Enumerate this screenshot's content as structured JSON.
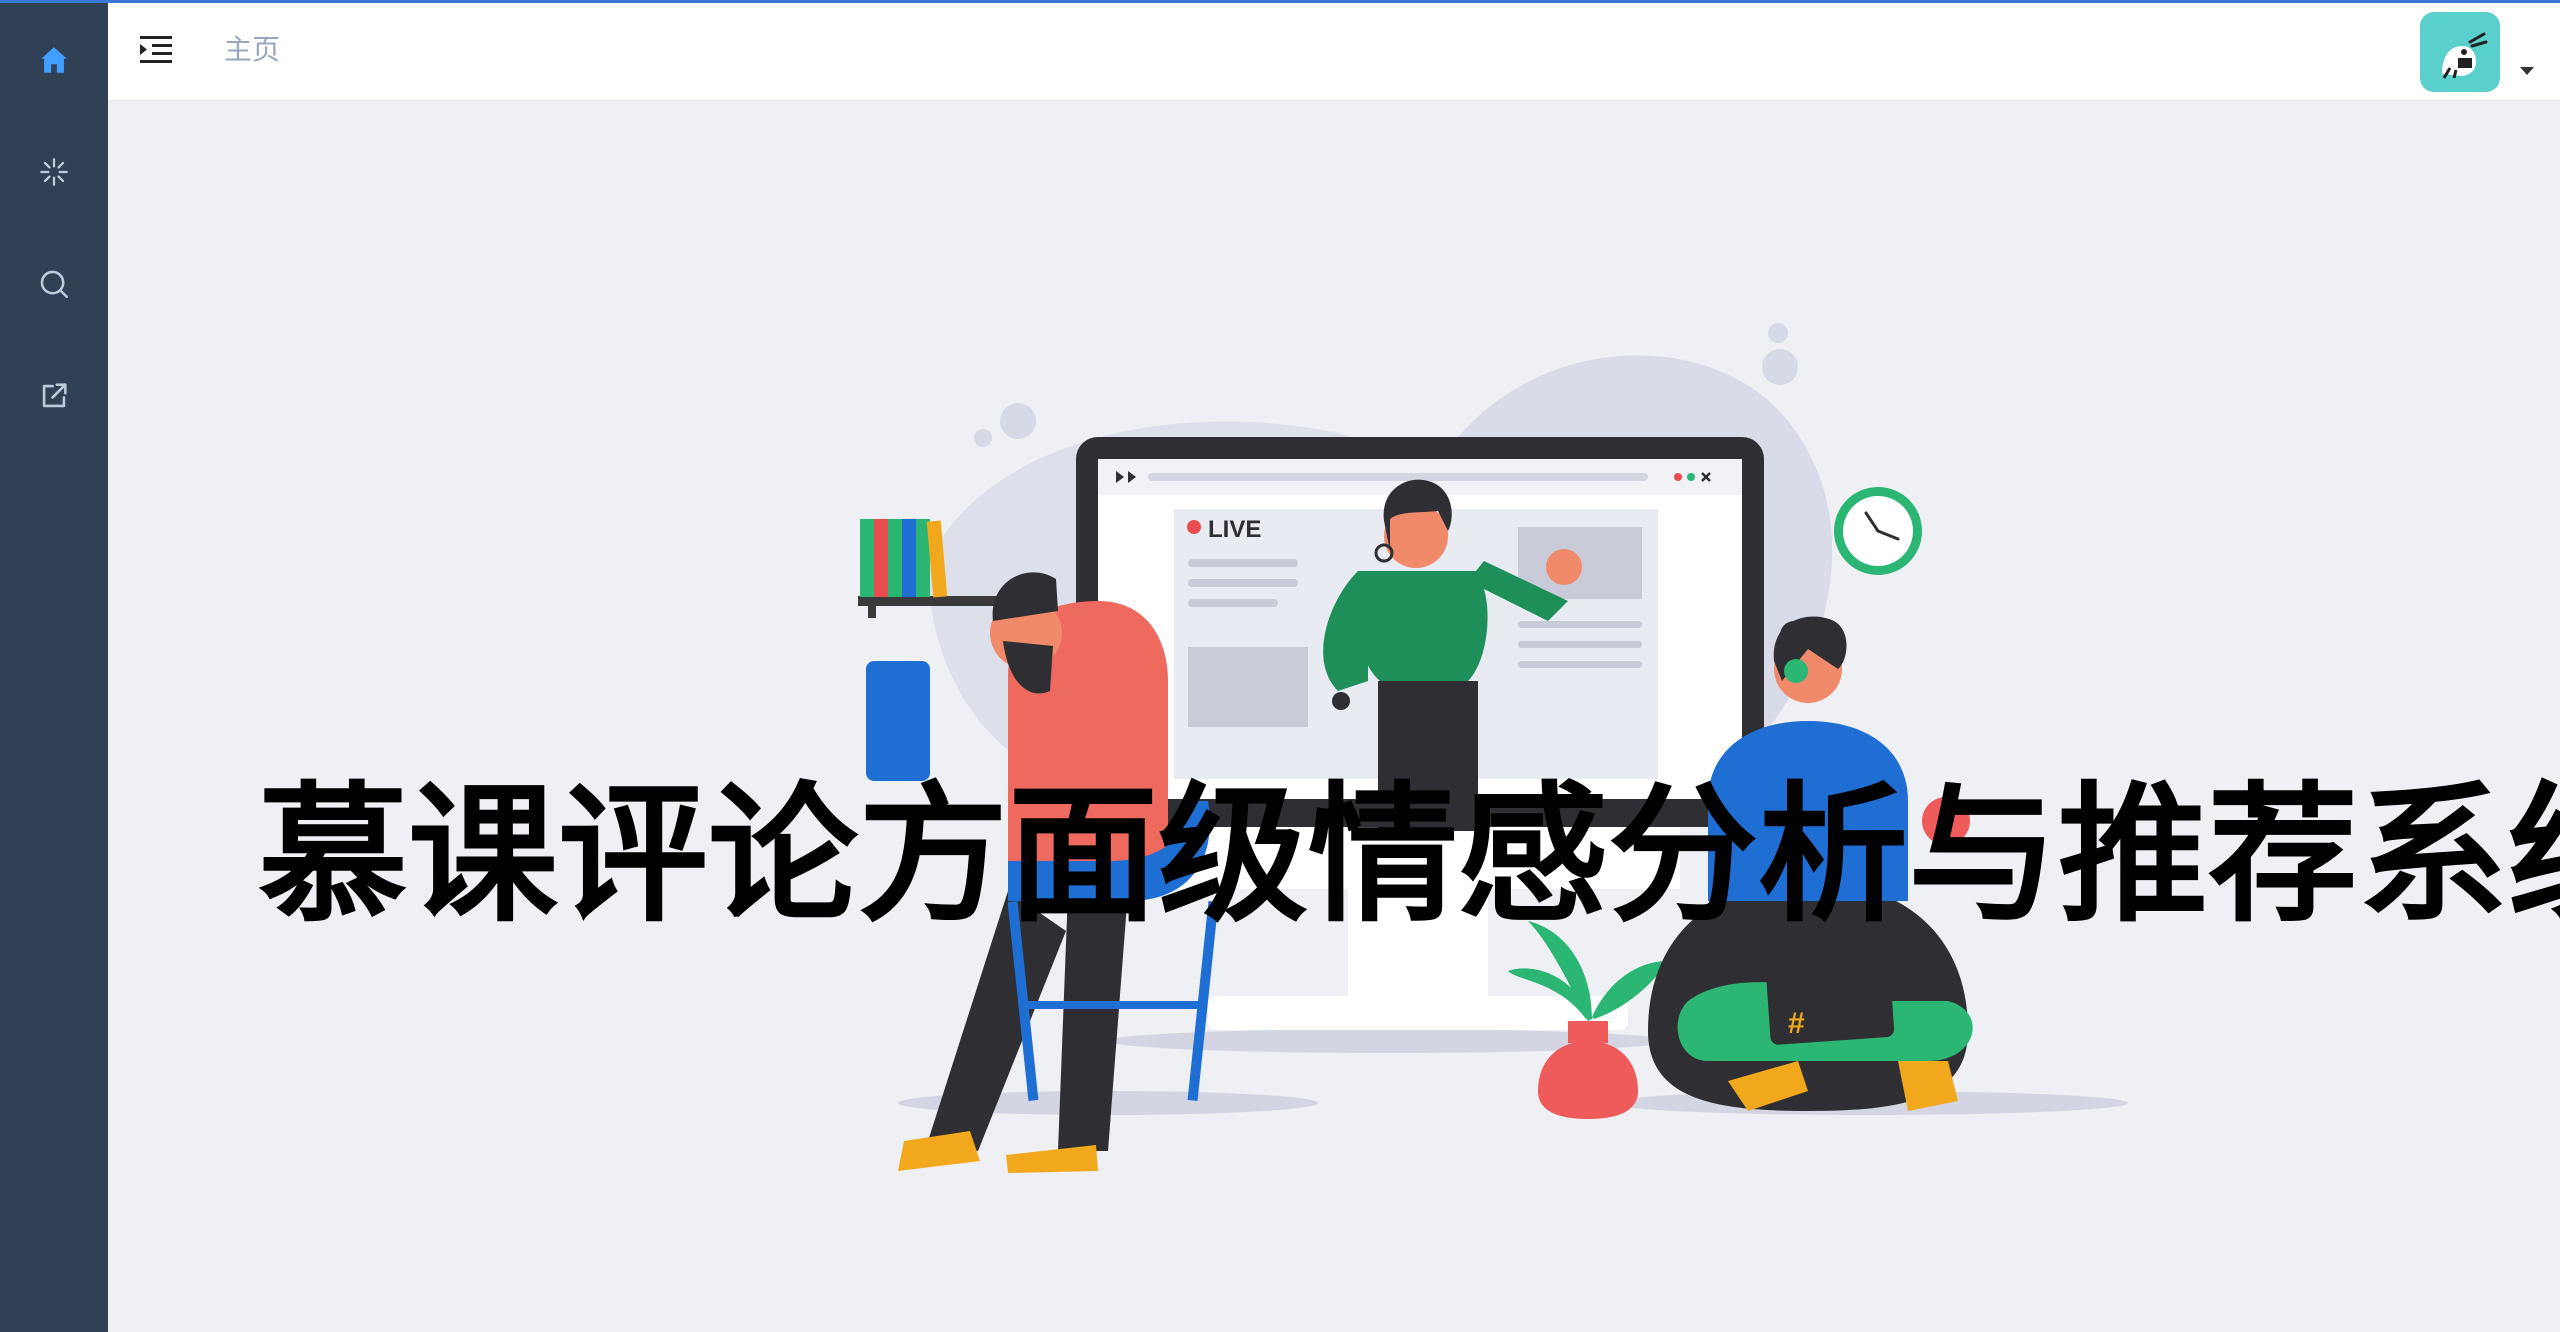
{
  "sidebar": {
    "items": [
      {
        "icon": "home-icon",
        "active": true
      },
      {
        "icon": "sparkle-icon",
        "active": false
      },
      {
        "icon": "search-icon",
        "active": false
      },
      {
        "icon": "external-link-icon",
        "active": false
      }
    ],
    "active_color": "#409eff",
    "icon_color": "#bfcbd9"
  },
  "header": {
    "breadcrumb": "主页"
  },
  "illustration": {
    "screen_badge": "LIVE",
    "laptop_symbol": "#"
  },
  "main": {
    "title": "慕课评论方面级情感分析与推荐系统"
  }
}
